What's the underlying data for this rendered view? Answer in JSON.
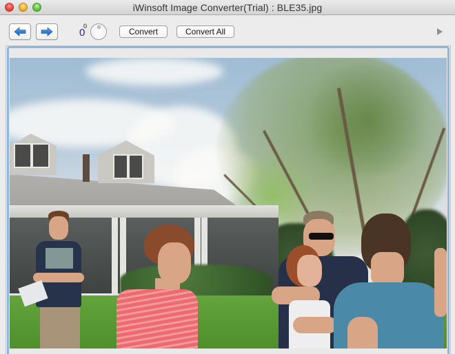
{
  "window": {
    "title": "iWinsoft Image Converter(Trial) : BLE35.jpg",
    "controls": [
      "close",
      "minimize",
      "zoom"
    ]
  },
  "toolbar": {
    "back_icon": "arrow-left-icon",
    "forward_icon": "arrow-right-icon",
    "rotation_value": "0",
    "rotation_unit": "0",
    "rotation_knob_icon": "rotation-knob-icon",
    "convert_label": "Convert",
    "convert_all_label": "Convert All",
    "play_icon": "play-triangle-icon"
  },
  "preview": {
    "file_name": "BLE35.jpg",
    "description": "Outdoor photo: family greeting on a lawn in front of a grey house with dormer windows and large trees",
    "focus_ring_color": "#8fb6e3"
  },
  "colors": {
    "accent_arrow": "#1d6fd0",
    "rotation_text": "#3a1fa5"
  }
}
